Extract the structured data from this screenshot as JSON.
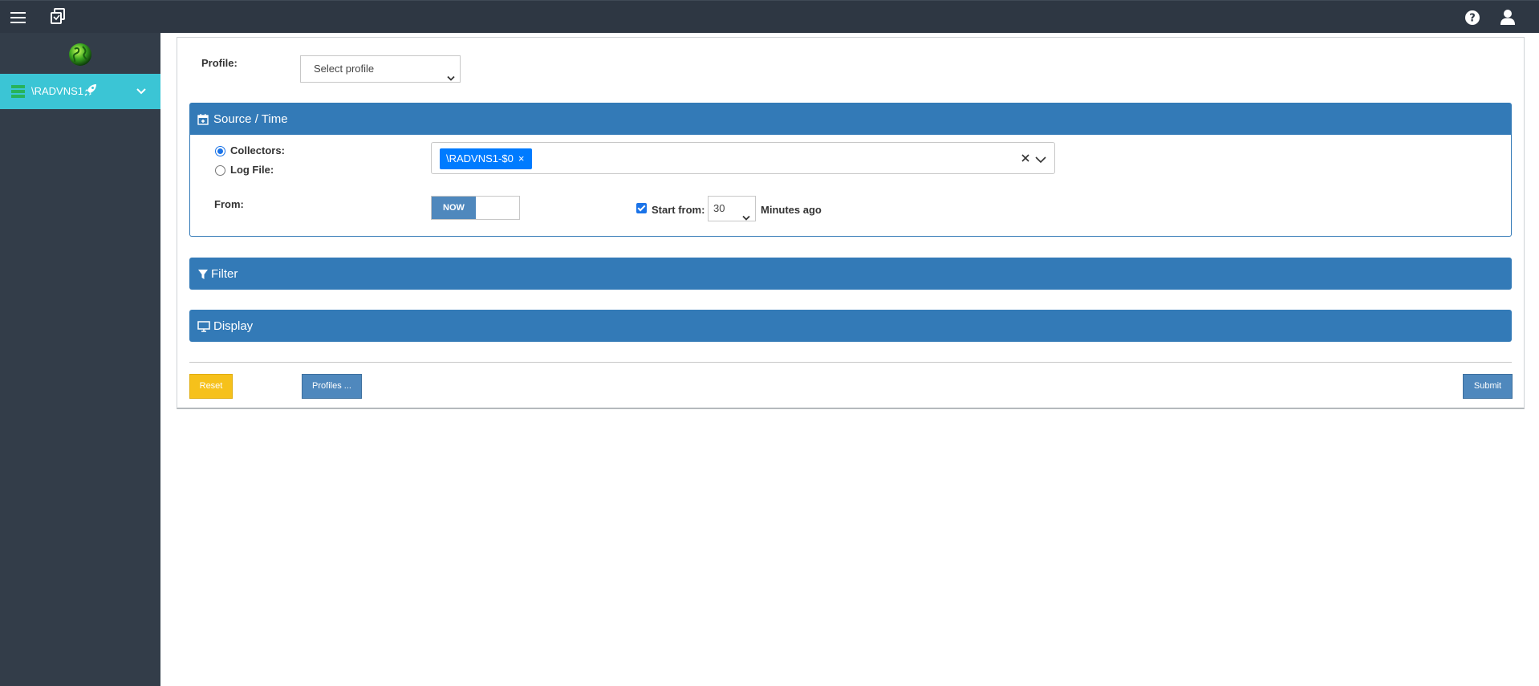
{
  "sidebar": {
    "node_label": "\\RADVNS1"
  },
  "form": {
    "profile_label": "Profile:",
    "profile_select_value": "Select profile",
    "source_time": {
      "title": "Source / Time",
      "collectors_label": "Collectors:",
      "logfile_label": "Log File:",
      "selected_source": "collectors",
      "collector_chip": "\\RADVNS1-$0",
      "chip_remove": "×",
      "from_label": "From:",
      "now_label": "NOW",
      "start_from_label": "Start from:",
      "start_from_value": "30",
      "start_from_checked": true,
      "minutes_ago_label": "Minutes ago"
    },
    "filter_title": "Filter",
    "display_title": "Display"
  },
  "buttons": {
    "reset": "Reset",
    "profiles": "Profiles ...",
    "submit": "Submit"
  },
  "colors": {
    "topbar": "#2e3743",
    "sidebar": "#333d49",
    "sidebar_active": "#3bc5d5",
    "section_header": "#337ab7",
    "chip": "#007bff",
    "reset": "#f6c11b",
    "primary_button": "#4f88bd"
  }
}
